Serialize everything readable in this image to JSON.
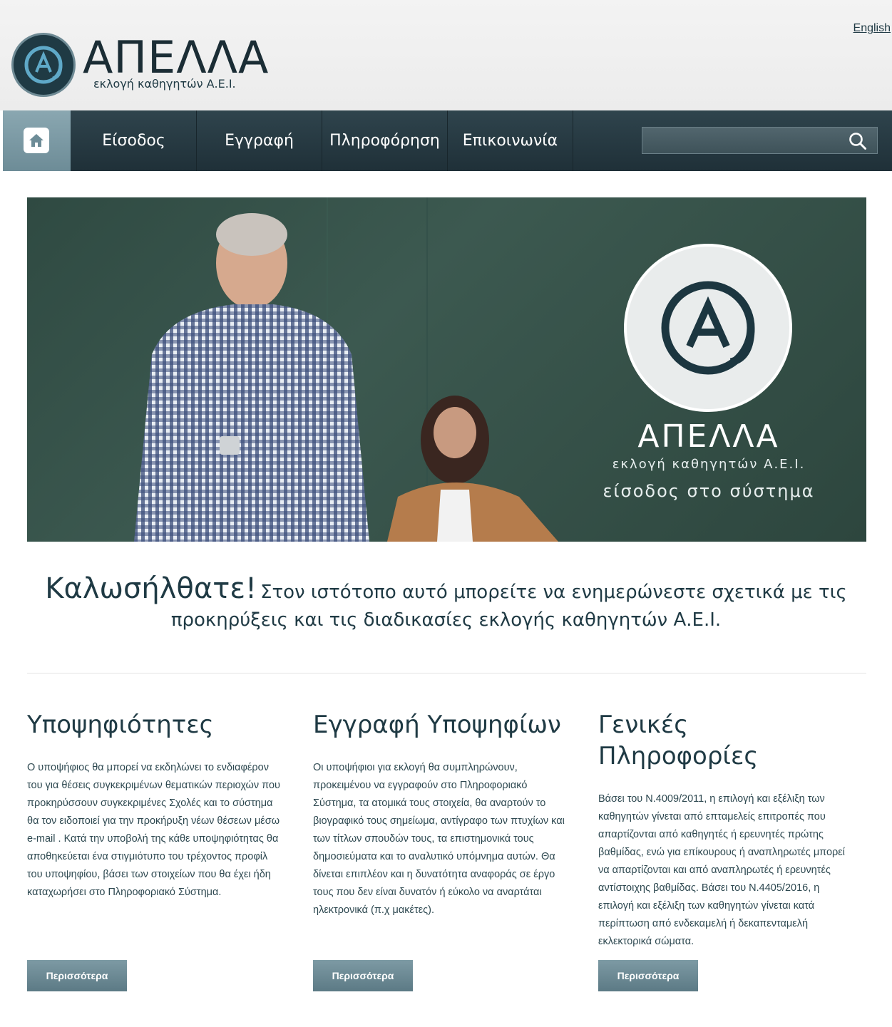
{
  "header": {
    "language_link": "English",
    "logo_title": "ΑΠΕΛΛΑ",
    "logo_subtitle": "εκλογή καθηγητών Α.Ε.Ι."
  },
  "nav": {
    "items": [
      {
        "label": "Είσοδος"
      },
      {
        "label": "Εγγραφή"
      },
      {
        "label": "Πληροφόρηση"
      },
      {
        "label": "Επικοινωνία"
      }
    ],
    "search": {
      "value": "",
      "placeholder": ""
    }
  },
  "hero": {
    "title": "ΑΠΕΛΛΑ",
    "subtitle": "εκλογή καθηγητών Α.Ε.Ι.",
    "login_link": "είσοδος στο σύστημα"
  },
  "welcome": {
    "heading": "Καλωσήλθατε!",
    "text": "Στον ιστότοπο αυτό μπορείτε να ενημερώνεστε σχετικά με τις προκηρύξεις και τις διαδικασίες εκλογής καθηγητών Α.Ε.Ι."
  },
  "columns": [
    {
      "title": "Υποψηφιότητες",
      "body": "Ο υποψήφιος θα μπορεί να εκδηλώνει το ενδιαφέρον του για θέσεις συγκεκριμένων θεματικών περιοχών που προκηρύσσουν συγκεκριμένες Σχολές και το σύστημα θα τον ειδοποιεί για την προκήρυξη νέων θέσεων μέσω e-mail . Κατά την υποβολή της κάθε υποψηφιότητας θα αποθηκεύεται ένα στιγμιότυπο του τρέχοντος προφίλ του υποψηφίου, βάσει των στοιχείων που θα έχει ήδη καταχωρήσει στο Πληροφοριακό Σύστημα.",
      "button": "Περισσότερα"
    },
    {
      "title": "Εγγραφή Υποψηφίων",
      "body": "Οι υποψήφιοι για εκλογή θα συμπληρώνουν, προκειμένου να εγγραφούν στο Πληροφοριακό Σύστημα, τα ατομικά τους στοιχεία, θα αναρτούν το βιογραφικό τους σημείωμα, αντίγραφο των πτυχίων και των τίτλων σπουδών τους, τα επιστημονικά τους δημοσιεύματα και το αναλυτικό υπόμνημα αυτών. Θα δίνεται επιπλέον και η δυνατότητα αναφοράς σε έργο τους που δεν είναι δυνατόν ή εύκολο να αναρτάται ηλεκτρονικά (π.χ μακέτες).",
      "button": "Περισσότερα"
    },
    {
      "title": "Γενικές Πληροφορίες",
      "body": "Βάσει του Ν.4009/2011, η επιλογή και εξέλιξη των καθηγητών γίνεται από επταμελείς επιτροπές που απαρτίζονται από καθηγητές ή ερευνητές πρώτης βαθμίδας, ενώ για επίκουρους ή αναπληρωτές μπορεί να απαρτίζονται και από αναπληρωτές ή ερευνητές αντίστοιχης βαθμίδας. Βάσει του Ν.4405/2016, η επιλογή και εξέλιξη των καθηγητών γίνεται κατά περίπτωση από ενδεκαμελή ή δεκαπενταμελή εκλεκτορικά σώματα.",
      "button": "Περισσότερα"
    }
  ],
  "colors": {
    "brand_dark": "#1f3a44",
    "nav_bg": "#283b43",
    "accent": "#6d8c97"
  }
}
